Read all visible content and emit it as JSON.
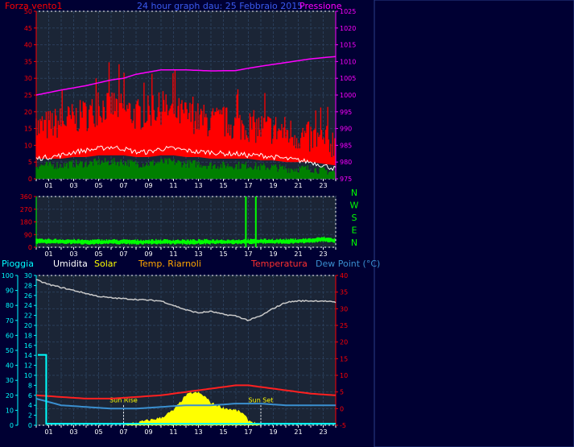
{
  "header": {
    "left_label": "Forza vento1",
    "title": "24 hour graph dau: 25 Febbraio 2015",
    "right_label": "Pressione"
  },
  "legend": {
    "rain": "Pioggia",
    "humidity": "Umidita",
    "solar": "Solar",
    "soil_temp": "Temp. Riarnoli",
    "temperature": "Temperatura",
    "dew_point": "Dew Point (°C)"
  },
  "sun": {
    "rise": "Sun Rise",
    "set": "Sun Set"
  },
  "compass": [
    "N",
    "W",
    "S",
    "E",
    "N"
  ],
  "colors": {
    "background": "#000033",
    "plot": "#1b2536",
    "grid": "#2a3e5a",
    "wind": "#ff0000",
    "gust": "#ffffff",
    "avg_wind": "#008000",
    "pressure": "#ff00ff",
    "direction": "#00ff00",
    "humidity": "#c8c8c8",
    "temperature": "#ff2020",
    "dew_point": "#3a8fd0",
    "solar": "#ffff00",
    "rain": "#00ffff"
  },
  "chart_data": [
    {
      "id": "wind_pressure",
      "type": "line",
      "x_ticks": [
        "01",
        "03",
        "05",
        "07",
        "09",
        "11",
        "13",
        "15",
        "17",
        "19",
        "21",
        "23"
      ],
      "y_left": {
        "ticks": [
          0,
          5,
          10,
          15,
          20,
          25,
          30,
          35,
          40,
          45,
          50
        ],
        "lim": [
          0,
          50
        ]
      },
      "y_right": {
        "ticks": [
          975,
          980,
          985,
          990,
          995,
          1000,
          1005,
          1010,
          1015,
          1020,
          1025
        ],
        "lim": [
          975,
          1025
        ]
      },
      "series": [
        {
          "key": "pressure",
          "axis": "right",
          "x": [
            0,
            2,
            4,
            6,
            7,
            8,
            10,
            12,
            14,
            16,
            17,
            18,
            20,
            22,
            24
          ],
          "y": [
            1000,
            1001.5,
            1002.8,
            1004.5,
            1005,
            1006.2,
            1007.5,
            1007.5,
            1007.2,
            1007.3,
            1008,
            1008.6,
            1009.7,
            1010.8,
            1011.5
          ]
        },
        {
          "key": "wind",
          "axis": "left",
          "x": [
            0,
            1,
            2,
            3,
            4,
            5,
            6,
            7,
            8,
            9,
            10,
            11,
            12,
            13,
            14,
            15,
            16,
            17,
            18,
            19,
            20,
            21,
            22,
            23,
            24
          ],
          "y": [
            13,
            14,
            15,
            16,
            17,
            19,
            20,
            19,
            17,
            18,
            19,
            18,
            17,
            16,
            15,
            15,
            14,
            14,
            13,
            13,
            12,
            11,
            10,
            9,
            9
          ]
        },
        {
          "key": "gust",
          "axis": "left",
          "x": [
            0,
            1,
            2,
            3,
            4,
            5,
            6,
            7,
            8,
            9,
            10,
            11,
            12,
            13,
            14,
            15,
            16,
            17,
            18,
            19,
            20,
            21,
            22,
            23,
            24
          ],
          "y": [
            6,
            6.5,
            7,
            8,
            8.5,
            9,
            9.5,
            9,
            8,
            8,
            9,
            9,
            8.5,
            8,
            8,
            7.5,
            7.5,
            7,
            7,
            6.5,
            6,
            5.5,
            5,
            4,
            3
          ]
        },
        {
          "key": "avg_wind",
          "axis": "left",
          "x": [
            0,
            1,
            2,
            3,
            4,
            5,
            6,
            7,
            8,
            9,
            10,
            11,
            12,
            13,
            14,
            15,
            16,
            17,
            18,
            19,
            20,
            21,
            22,
            23,
            24
          ],
          "y": [
            4,
            4,
            4,
            4.5,
            4.5,
            5,
            5,
            5,
            4.5,
            4.5,
            5,
            5,
            4.5,
            4.5,
            4,
            4,
            4,
            4,
            3.5,
            3.5,
            3,
            3,
            3,
            2.5,
            2
          ]
        }
      ]
    },
    {
      "id": "wind_direction",
      "type": "line",
      "x_ticks": [
        "01",
        "03",
        "05",
        "07",
        "09",
        "11",
        "13",
        "15",
        "17",
        "19",
        "21",
        "23"
      ],
      "y_left": {
        "ticks": [
          0,
          90,
          180,
          270,
          360
        ],
        "lim": [
          0,
          360
        ]
      },
      "series": [
        {
          "key": "direction",
          "x": [
            0,
            2,
            4,
            6,
            8,
            10,
            12,
            14,
            16,
            18,
            20,
            22,
            23,
            24
          ],
          "y": [
            45,
            45,
            40,
            42,
            40,
            42,
            40,
            42,
            42,
            45,
            45,
            50,
            60,
            50
          ]
        }
      ],
      "spikes": [
        {
          "x": 16.8,
          "y": 360
        },
        {
          "x": 17.6,
          "y": 360
        }
      ]
    },
    {
      "id": "temp_hum_rain",
      "type": "line",
      "x_ticks": [
        "01",
        "03",
        "05",
        "07",
        "09",
        "11",
        "13",
        "15",
        "17",
        "19",
        "21",
        "23"
      ],
      "y_rain": {
        "ticks": [
          0,
          10,
          20,
          30,
          40,
          50,
          60,
          70,
          80,
          90,
          100
        ],
        "lim": [
          0,
          100
        ]
      },
      "y_humidity": {
        "ticks": [
          0,
          2,
          4,
          6,
          8,
          10,
          12,
          14,
          16,
          18,
          20,
          22,
          24,
          26,
          28,
          30
        ],
        "lim": [
          0,
          30
        ]
      },
      "y_temp": {
        "ticks": [
          -5,
          0,
          5,
          10,
          15,
          20,
          25,
          30,
          35,
          40
        ],
        "lim": [
          -5,
          40
        ]
      },
      "series": [
        {
          "key": "humidity",
          "axis": "rain",
          "x": [
            0,
            1,
            2,
            3,
            4,
            5,
            6,
            8,
            10,
            11,
            12,
            13,
            14,
            15,
            16,
            17,
            18,
            19,
            20,
            21,
            22,
            23,
            24
          ],
          "y": [
            97,
            94,
            92,
            90,
            88,
            86,
            85,
            84,
            83,
            80,
            77,
            75,
            76,
            74,
            73,
            70,
            73,
            78,
            82,
            83,
            83,
            83,
            82
          ]
        },
        {
          "key": "temperature",
          "axis": "temp",
          "x": [
            0,
            2,
            4,
            6,
            8,
            10,
            12,
            14,
            16,
            17,
            18,
            20,
            22,
            24
          ],
          "y": [
            4,
            3.5,
            3,
            3,
            3.5,
            4,
            5,
            6,
            7,
            7,
            6.5,
            5.5,
            4.5,
            4
          ]
        },
        {
          "key": "dew_point",
          "axis": "temp",
          "x": [
            0,
            2,
            4,
            6,
            8,
            10,
            12,
            14,
            16,
            18,
            20,
            22,
            24
          ],
          "y": [
            3,
            1,
            0.5,
            0,
            0,
            0.5,
            1,
            1,
            1.5,
            1.5,
            1,
            1,
            1
          ]
        },
        {
          "key": "solar",
          "axis": "humidity",
          "x": [
            0,
            7,
            8,
            9,
            10,
            11,
            11.5,
            12,
            12.5,
            13,
            13.5,
            14,
            15,
            16,
            16.5,
            17,
            18,
            24
          ],
          "y": [
            0,
            0,
            0.5,
            1,
            1.5,
            3,
            4.5,
            6,
            6.5,
            6.5,
            5.8,
            4.5,
            3.5,
            3,
            2.5,
            1,
            0,
            0
          ]
        },
        {
          "key": "rain",
          "axis": "rain",
          "x": [
            0,
            0.8,
            0.8,
            24
          ],
          "y": [
            47,
            47,
            1,
            1
          ]
        }
      ]
    }
  ]
}
